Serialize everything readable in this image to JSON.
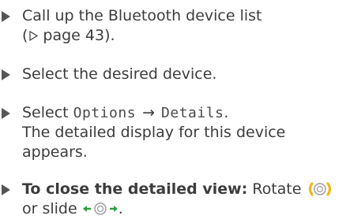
{
  "steps": [
    {
      "line1": "Call up the Bluetooth device list",
      "ref_prefix": "(",
      "ref_text": "page 43).",
      "ref_icon": "page-reference-triangle-icon"
    },
    {
      "text": "Select the desired device."
    },
    {
      "select_label": "Select",
      "menu_item_1": "Options",
      "menu_arrow": "→",
      "menu_item_2": "Details",
      "period": ".",
      "result_line1": "The detailed display for this device",
      "result_line2": "appears."
    },
    {
      "bold_text": "To close the detailed view:",
      "rotate_text": "Rotate",
      "rotate_icon": "controller-rotate-icon",
      "line2_prefix": "or slide",
      "slide_icon": "controller-slide-left-right-icon",
      "period": "."
    }
  ],
  "colors": {
    "text": "#3c3c3c",
    "marker": "#555555",
    "icon_accent": "#f2b400",
    "icon_gray": "#9a9a9a",
    "slide_arrow": "#2f9e3a"
  }
}
